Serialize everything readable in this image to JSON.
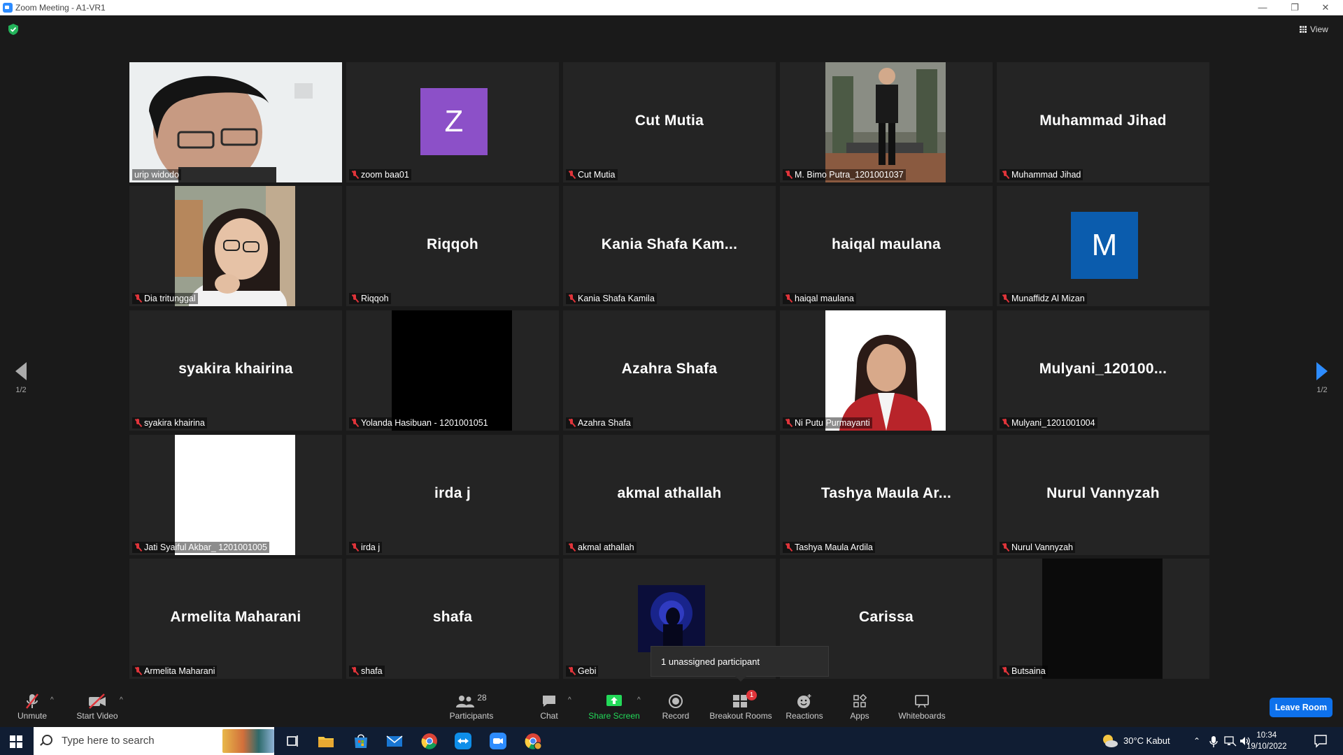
{
  "window": {
    "title": "Zoom Meeting - A1-VR1",
    "min": "—",
    "max": "❐",
    "close": "✕"
  },
  "top": {
    "view_label": "View"
  },
  "pager": {
    "left": "1/2",
    "right": "1/2"
  },
  "participants": [
    {
      "name": "urip widodo",
      "display": "",
      "kind": "video",
      "muted": false,
      "active": true
    },
    {
      "name": "zoom baa01",
      "display": "",
      "kind": "avatar",
      "avatar_letter": "Z",
      "avatar_color": "#8c50c8",
      "muted": true
    },
    {
      "name": "Cut Mutia",
      "display": "Cut Mutia",
      "kind": "name",
      "muted": true
    },
    {
      "name": "M. Bimo Putra_1201001037",
      "display": "",
      "kind": "video",
      "muted": true
    },
    {
      "name": "Muhammad Jihad",
      "display": "Muhammad Jihad",
      "kind": "name",
      "muted": true
    },
    {
      "name": "Dia tritunggal",
      "display": "",
      "kind": "video",
      "muted": true
    },
    {
      "name": "Riqqoh",
      "display": "Riqqoh",
      "kind": "name",
      "muted": true
    },
    {
      "name": "Kania Shafa Kamila",
      "display": "Kania  Shafa  Kam...",
      "kind": "name",
      "muted": true
    },
    {
      "name": "haiqal maulana",
      "display": "haiqal maulana",
      "kind": "name",
      "muted": true
    },
    {
      "name": "Munaffidz Al Mizan",
      "display": "",
      "kind": "avatar",
      "avatar_letter": "M",
      "avatar_color": "#0b5cad",
      "muted": true
    },
    {
      "name": "syakira khairina",
      "display": "syakira khairina",
      "kind": "name",
      "muted": true
    },
    {
      "name": "Yolanda Hasibuan - 1201001051",
      "display": "",
      "kind": "video",
      "muted": true
    },
    {
      "name": "Azahra Shafa",
      "display": "Azahra Shafa",
      "kind": "name",
      "muted": true
    },
    {
      "name": "Ni Putu Purmayanti",
      "display": "",
      "kind": "video",
      "muted": true
    },
    {
      "name": "Mulyani_1201001004",
      "display": "Mulyani_120100...",
      "kind": "name",
      "muted": true
    },
    {
      "name": "Jati Syaiful Akbar_ 1201001005",
      "display": "",
      "kind": "video",
      "muted": true
    },
    {
      "name": "irda j",
      "display": "irda j",
      "kind": "name",
      "muted": true
    },
    {
      "name": "akmal athallah",
      "display": "akmal athallah",
      "kind": "name",
      "muted": true
    },
    {
      "name": "Tashya Maula Ardila",
      "display": "Tashya  Maula  Ar...",
      "kind": "name",
      "muted": true
    },
    {
      "name": "Nurul Vannyzah",
      "display": "Nurul Vannyzah",
      "kind": "name",
      "muted": true
    },
    {
      "name": "Armelita Maharani",
      "display": "Armelita Maharani",
      "kind": "name",
      "muted": true
    },
    {
      "name": "shafa",
      "display": "shafa",
      "kind": "name",
      "muted": true
    },
    {
      "name": "Gebi",
      "display": "",
      "kind": "video",
      "muted": true
    },
    {
      "name": "Carissa",
      "display": "Carissa",
      "kind": "name",
      "muted": true
    },
    {
      "name": "Butsaina",
      "display": "",
      "kind": "video",
      "muted": true
    }
  ],
  "popup": {
    "text": "1 unassigned participant"
  },
  "toolbar": {
    "unmute": "Unmute",
    "start_video": "Start Video",
    "participants": "Participants",
    "participants_count": "28",
    "chat": "Chat",
    "share_screen": "Share Screen",
    "record": "Record",
    "breakout_rooms": "Breakout Rooms",
    "breakout_badge": "1",
    "reactions": "Reactions",
    "apps": "Apps",
    "whiteboards": "Whiteboards",
    "leave": "Leave Room"
  },
  "colors": {
    "share_green": "#23d959",
    "leave_blue": "#0e71eb",
    "active_speaker": "#f2f26b",
    "muted_red": "#e0343a"
  },
  "taskbar": {
    "search_placeholder": "Type here to search",
    "weather": "30°C  Kabut",
    "time": "10:34",
    "date": "19/10/2022"
  }
}
